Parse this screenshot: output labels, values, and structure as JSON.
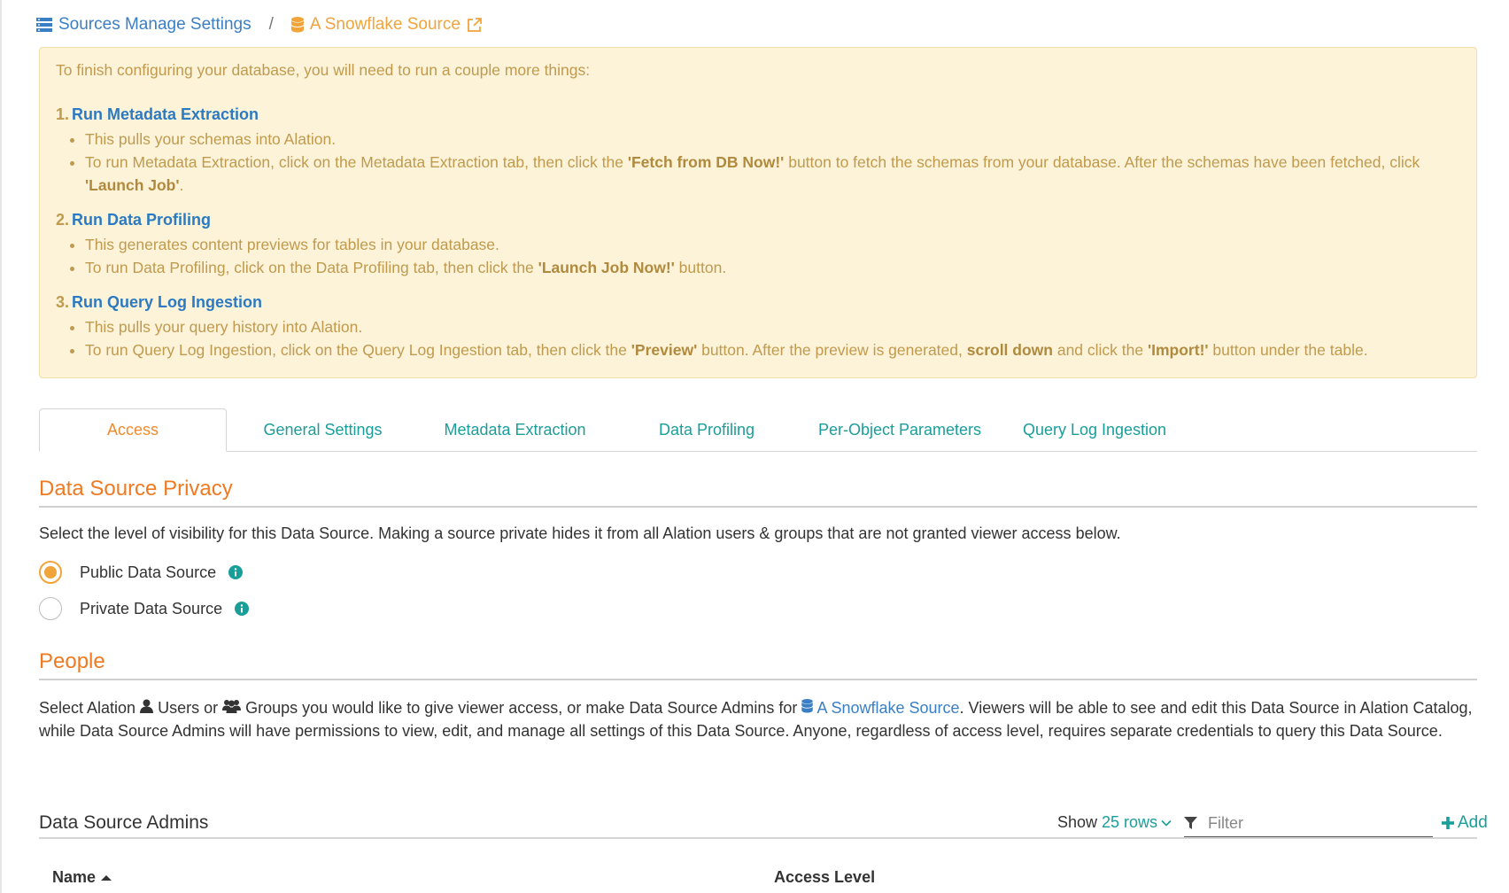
{
  "breadcrumb": {
    "sources_label": "Sources Manage Settings",
    "separator": "/",
    "source_label": "A Snowflake Source"
  },
  "alert": {
    "intro": "To finish configuring your database, you will need to run a couple more things:",
    "steps": [
      {
        "number": "1.",
        "title": "Run Metadata Extraction",
        "bullets": [
          {
            "parts": [
              {
                "t": "This pulls your schemas into Alation."
              }
            ]
          },
          {
            "parts": [
              {
                "t": "To run Metadata Extraction, click on the Metadata Extraction tab, then click the "
              },
              {
                "t": "'Fetch from DB Now!'",
                "b": true
              },
              {
                "t": " button to fetch the schemas from your database. After the schemas have been fetched, click "
              },
              {
                "t": "'Launch Job'",
                "b": true
              },
              {
                "t": "."
              }
            ]
          }
        ]
      },
      {
        "number": "2.",
        "title": "Run Data Profiling",
        "bullets": [
          {
            "parts": [
              {
                "t": "This generates content previews for tables in your database."
              }
            ]
          },
          {
            "parts": [
              {
                "t": "To run Data Profiling, click on the Data Profiling tab, then click the "
              },
              {
                "t": "'Launch Job Now!'",
                "b": true
              },
              {
                "t": " button."
              }
            ]
          }
        ]
      },
      {
        "number": "3.",
        "title": "Run Query Log Ingestion",
        "bullets": [
          {
            "parts": [
              {
                "t": "This pulls your query history into Alation."
              }
            ]
          },
          {
            "parts": [
              {
                "t": "To run Query Log Ingestion, click on the Query Log Ingestion tab, then click the "
              },
              {
                "t": "'Preview'",
                "b": true
              },
              {
                "t": " button. After the preview is generated, "
              },
              {
                "t": "scroll down",
                "b": true
              },
              {
                "t": " and click the "
              },
              {
                "t": "'Import!'",
                "b": true
              },
              {
                "t": " button under the table."
              }
            ]
          }
        ]
      }
    ]
  },
  "tabs": [
    {
      "label": "Access",
      "active": true
    },
    {
      "label": "General Settings",
      "active": false
    },
    {
      "label": "Metadata Extraction",
      "active": false
    },
    {
      "label": "Data Profiling",
      "active": false
    },
    {
      "label": "Per-Object Parameters",
      "active": false
    },
    {
      "label": "Query Log Ingestion",
      "active": false
    }
  ],
  "privacy": {
    "title": "Data Source Privacy",
    "description": "Select the level of visibility for this Data Source. Making a source private hides it from all Alation users & groups that are not granted viewer access below.",
    "options": [
      {
        "label": "Public Data Source",
        "checked": true
      },
      {
        "label": "Private Data Source",
        "checked": false
      }
    ]
  },
  "people": {
    "title": "People",
    "desc_1": "Select Alation ",
    "users_label": "Users",
    "desc_or": " or ",
    "groups_label": "Groups",
    "desc_2": " you would like to give viewer access, or make Data Source Admins for ",
    "source_link": "A Snowflake Source",
    "desc_3": ". Viewers will be able to see and edit this Data Source in Alation Catalog, while Data Source Admins will have permissions to view, edit, and manage all settings of this Data Source. Anyone, regardless of access level, requires separate credentials to query this Data Source."
  },
  "admins": {
    "title": "Data Source Admins",
    "show_label": "Show",
    "rows_label": "25 rows",
    "filter_placeholder": "Filter",
    "add_label": "Add",
    "columns": {
      "name": "Name",
      "access_level": "Access Level"
    }
  },
  "colors": {
    "accent_orange": "#ef7a22",
    "teal": "#1a9e9a",
    "link_blue": "#3a7fc4",
    "alert_bg": "#fdf3d8"
  }
}
